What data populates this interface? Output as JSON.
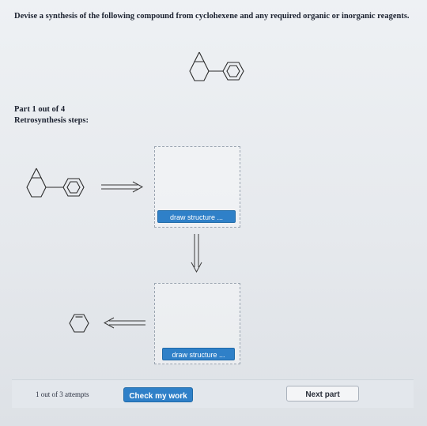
{
  "question": {
    "text": "Devise a synthesis of the following compound from cyclohexene and any required organic or inorganic reagents."
  },
  "part": {
    "label": "Part 1 out of 4",
    "steps_label": "Retrosynthesis steps:"
  },
  "molecules": {
    "target": "cyclopropyl-cyclohexyl-benzene-structure",
    "target_retro": "cyclopropyl-cyclohexyl-benzene-structure",
    "start": "cyclohexene-structure"
  },
  "draw_buttons": {
    "first": "draw structure ...",
    "second": "draw structure ..."
  },
  "footer": {
    "attempts": "1 out of 3 attempts",
    "check_label": "Check my work",
    "next_label": "Next part"
  },
  "colors": {
    "primary_button": "#2f80c8",
    "bond_line": "#2a2a2a"
  }
}
